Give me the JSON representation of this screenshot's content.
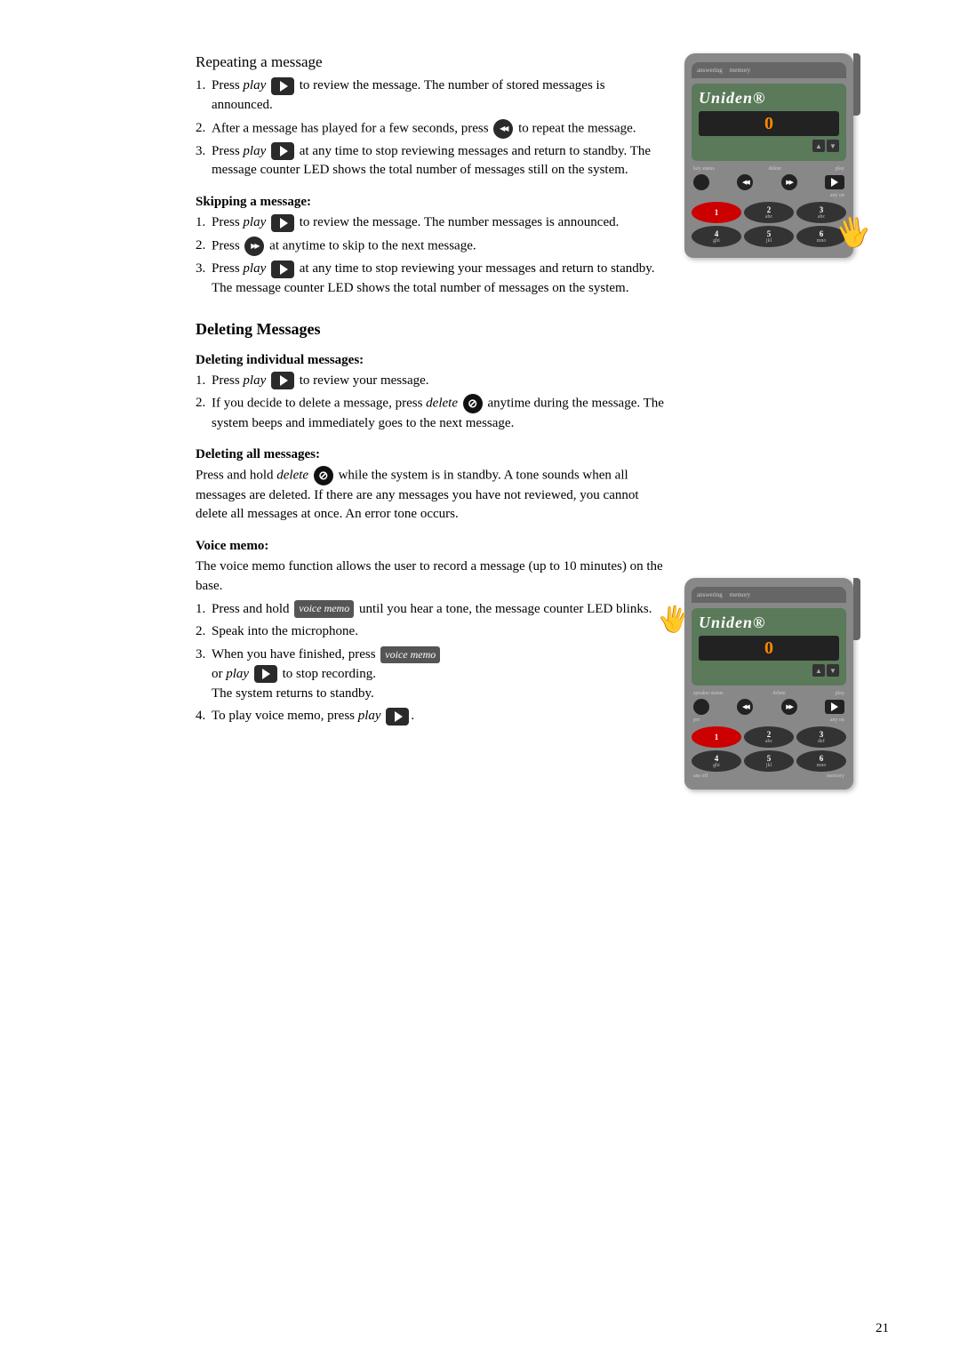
{
  "page": {
    "number": "21"
  },
  "sections": {
    "repeating": {
      "title": "Repeating a message",
      "items": [
        {
          "num": "1.",
          "text_before": "Press ",
          "italic": "play",
          "text_after": " to review the message. The number of stored messages is announced.",
          "has_play_btn": true,
          "btn_after_italic": true
        },
        {
          "num": "2.",
          "text": "After a message has played for a few seconds, press",
          "text_after": "to repeat the message.",
          "has_rewind": true
        },
        {
          "num": "3.",
          "text_before": "Press ",
          "italic": "play",
          "text_after": "at any time to stop reviewing messages and return to standby. The message counter LED shows the total number of messages still on the system.",
          "has_play_btn": true
        }
      ]
    },
    "skipping": {
      "title": "Skipping a message:",
      "items": [
        {
          "num": "1.",
          "text_before": "Press ",
          "italic": "play",
          "text_after": " to review the message. The number messages is announced.",
          "has_play_btn": true
        },
        {
          "num": "2.",
          "text": "Press",
          "text_after": "at anytime to skip to the next message.",
          "has_ff": true
        },
        {
          "num": "3.",
          "text_before": "Press ",
          "italic": "play",
          "text_after": "at any time to stop reviewing your messages and return to standby. The message counter LED shows the total number of messages on the system.",
          "has_play_btn": true
        }
      ]
    },
    "deleting": {
      "title": "Deleting Messages",
      "individual": {
        "title": "Deleting individual messages:",
        "items": [
          {
            "num": "1.",
            "text_before": "Press ",
            "italic": "play",
            "text_after": "to review your message.",
            "has_play_btn": true
          },
          {
            "num": "2.",
            "text_before": "If you decide to delete a message, press ",
            "italic": "delete",
            "text_after": "anytime during the message. The system beeps and immediately goes to the next message.",
            "has_delete": true
          }
        ]
      },
      "all": {
        "title": "Deleting all messages:",
        "text_before": "Press and hold ",
        "italic": "delete",
        "text_after": "while the system is in standby. A tone sounds when all messages are deleted. If there are any messages you have not reviewed, you cannot delete all messages at once. An error tone occurs.",
        "has_delete": true
      }
    },
    "voice_memo": {
      "title": "Voice memo:",
      "intro": "The voice memo function allows the user to record a message (up to 10 minutes) on the base.",
      "items": [
        {
          "num": "1.",
          "text_before": "Press and hold ",
          "badge": "voice memo",
          "text_after": "until you hear a tone, the message counter LED blinks."
        },
        {
          "num": "2.",
          "text": "Speak into the microphone."
        },
        {
          "num": "3.",
          "text_before": "When you have finished, press ",
          "badge": "voice memo",
          "text_middle": "or ",
          "italic": "play",
          "text_after": "to stop recording. The system returns to standby.",
          "has_play_btn": true
        },
        {
          "num": "4.",
          "text_before": "To play voice memo, press ",
          "italic": "play",
          "text_after": ".",
          "has_play_btn": true
        }
      ]
    }
  },
  "device": {
    "brand": "Uniden",
    "display": "0",
    "keypad": [
      {
        "num": "1",
        "sub": ""
      },
      {
        "num": "2",
        "sub": "abc"
      },
      {
        "num": "3",
        "sub": "abc"
      },
      {
        "num": "4",
        "sub": "ghi"
      },
      {
        "num": "5",
        "sub": "jkl"
      },
      {
        "num": "6",
        "sub": "mno"
      }
    ],
    "labels": {
      "speaker_status": "speaker status",
      "delete": "delete",
      "play": "play",
      "pre": "pre",
      "any_on": "any on",
      "ans_off": "ans off",
      "memory": "memory"
    }
  }
}
